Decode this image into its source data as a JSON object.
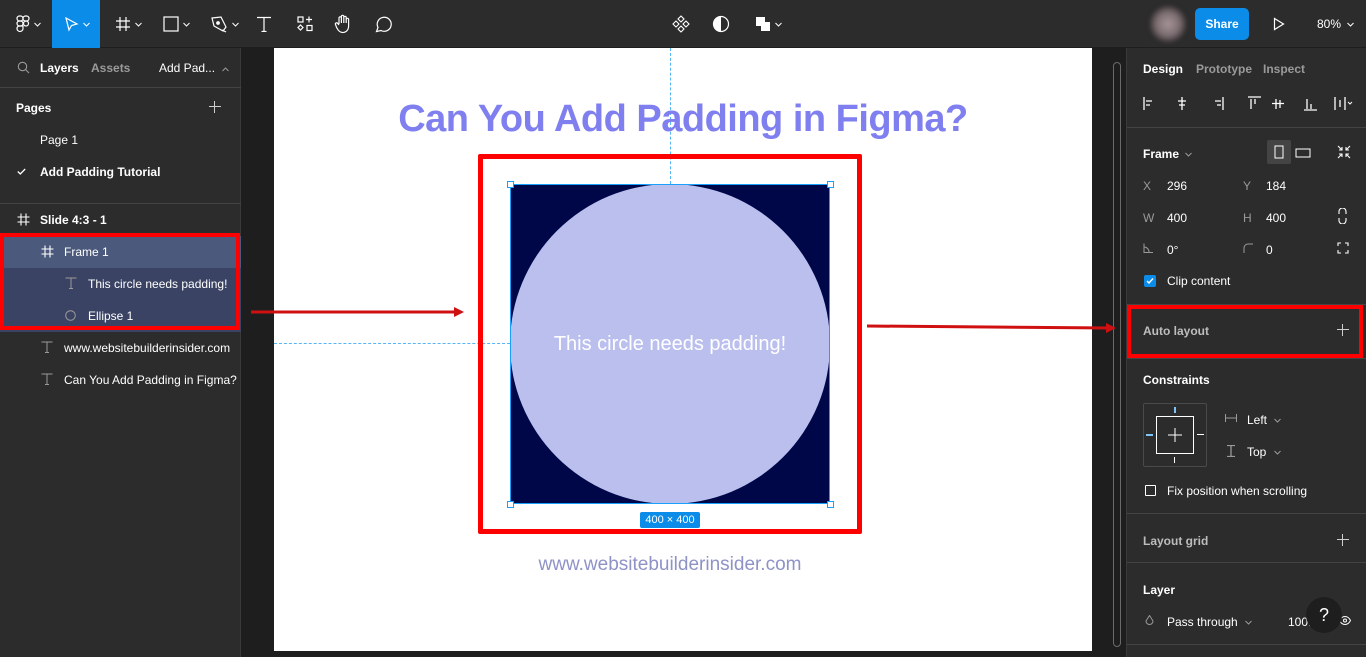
{
  "toolbar": {
    "tools": [
      {
        "name": "main-menu",
        "icon": "figma-logo-icon"
      },
      {
        "name": "move-tool",
        "icon": "cursor-arrow-icon",
        "active": true
      },
      {
        "name": "frame-tool",
        "icon": "frame-hash-icon"
      },
      {
        "name": "shape-tool",
        "icon": "rectangle-icon"
      },
      {
        "name": "pen-tool",
        "icon": "pen-icon"
      },
      {
        "name": "text-tool",
        "icon": "text-t-icon"
      },
      {
        "name": "resources-tool",
        "icon": "resources-icon"
      },
      {
        "name": "hand-tool",
        "icon": "hand-icon"
      },
      {
        "name": "comment-tool",
        "icon": "comment-bubble-icon"
      }
    ],
    "center_tools": [
      {
        "name": "component",
        "icon": "component-icon"
      },
      {
        "name": "mask",
        "icon": "contrast-icon"
      },
      {
        "name": "boolean",
        "icon": "boolean-union-icon"
      }
    ],
    "share_label": "Share",
    "zoom_level": "80%"
  },
  "left_panel": {
    "tabs": {
      "layers": "Layers",
      "assets": "Assets",
      "page_switch": "Add Pad..."
    },
    "pages_title": "Pages",
    "pages": [
      {
        "label": "Page 1",
        "current": false
      },
      {
        "label": "Add Padding Tutorial",
        "current": true
      }
    ],
    "layers": [
      {
        "label": "Slide 4:3 - 1",
        "icon": "frame-hash-icon",
        "depth": 0
      },
      {
        "label": "Frame 1",
        "icon": "frame-hash-icon",
        "depth": 1,
        "selected": true
      },
      {
        "label": "This circle needs padding!",
        "icon": "text-t-icon",
        "depth": 2
      },
      {
        "label": "Ellipse 1",
        "icon": "ellipse-icon",
        "depth": 2
      },
      {
        "label": "www.websitebuilderinsider.com",
        "icon": "text-t-icon",
        "depth": 1
      },
      {
        "label": "Can You Add Padding in Figma?",
        "icon": "text-t-icon",
        "depth": 1
      }
    ]
  },
  "canvas": {
    "slide_title": "Can You Add Padding in Figma?",
    "circle_text": "This circle needs padding!",
    "size_badge": "400 × 400",
    "site_url": "www.websitebuilderinsider.com",
    "colors": {
      "title": "#7f7ff0",
      "frame_fill": "#000748",
      "circle_fill": "#babfee",
      "url": "#8e92c6",
      "selection": "#18a0fb",
      "annotation": "#ff0000"
    }
  },
  "right_panel": {
    "tabs": {
      "design": "Design",
      "prototype": "Prototype",
      "inspect": "Inspect"
    },
    "frame_section": {
      "title": "Frame",
      "x_label": "X",
      "x": "296",
      "y_label": "Y",
      "y": "184",
      "w_label": "W",
      "w": "400",
      "h_label": "H",
      "h": "400",
      "rotation": "0°",
      "corner_radius": "0",
      "clip_content_label": "Clip content",
      "clip_content": true
    },
    "auto_layout_title": "Auto layout",
    "constraints": {
      "title": "Constraints",
      "horizontal": "Left",
      "vertical": "Top",
      "fix_position_label": "Fix position when scrolling",
      "fix_position": false
    },
    "layout_grid_title": "Layout grid",
    "layer": {
      "title": "Layer",
      "blend_mode": "Pass through",
      "opacity": "100."
    }
  },
  "help_label": "?"
}
